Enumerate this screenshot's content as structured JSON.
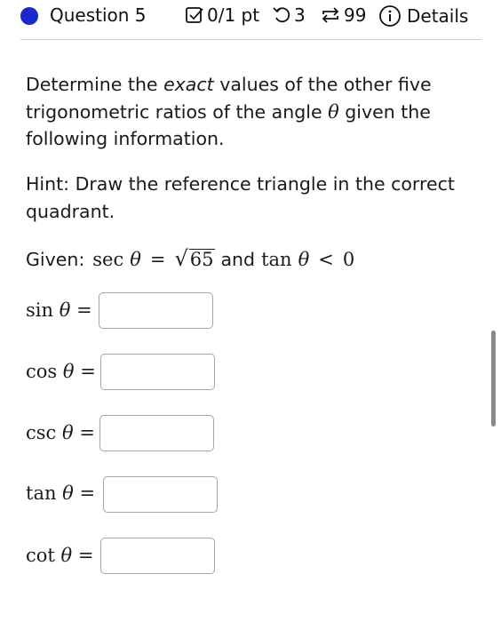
{
  "header": {
    "question_label": "Question 5",
    "score": "0/1 pt",
    "retries": "3",
    "attempts": "99",
    "details": "Details",
    "accent_color": "#1a29c9"
  },
  "problem": {
    "text_before": "Determine the ",
    "text_emph": "exact",
    "text_after": " values of the other five trigonometric ratios of the angle ",
    "theta": "θ",
    "text_end": " given the following information.",
    "hint": "Hint: Draw the reference triangle in the correct quadrant.",
    "given_label": "Given:",
    "sec_fn": "sec",
    "equals": "=",
    "sqrt_value": "65",
    "and_text": "and",
    "tan_fn": "tan",
    "less_than": "<",
    "zero": "0"
  },
  "answers": [
    {
      "fn": "sin",
      "value": ""
    },
    {
      "fn": "cos",
      "value": ""
    },
    {
      "fn": "csc",
      "value": ""
    },
    {
      "fn": "tan",
      "value": ""
    },
    {
      "fn": "cot",
      "value": ""
    }
  ]
}
